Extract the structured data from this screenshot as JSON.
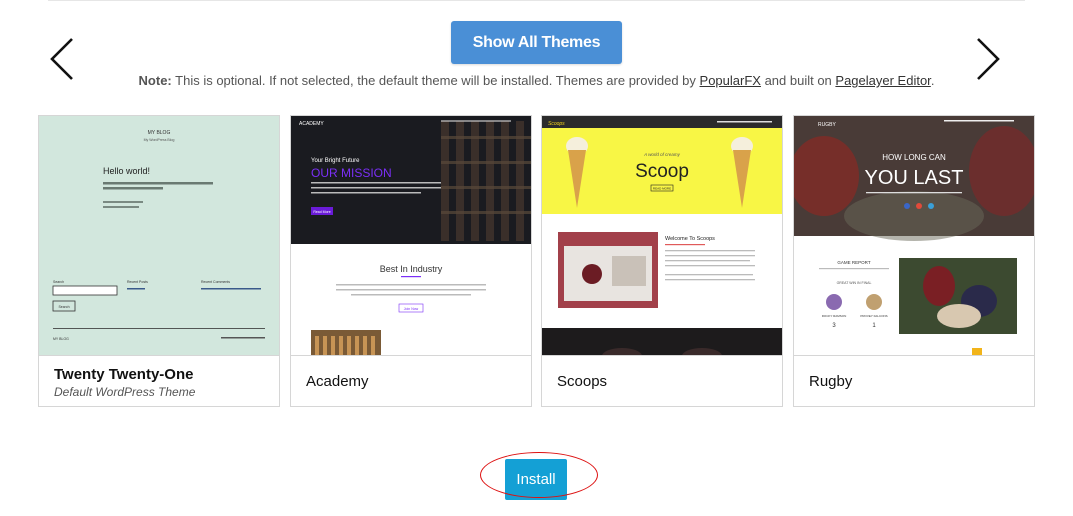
{
  "nav": {
    "prev_icon": "chevron-left-icon",
    "next_icon": "chevron-right-icon"
  },
  "show_all_label": "Show All Themes",
  "note": {
    "prefix": "Note:",
    "text": " This is optional. If not selected, the default theme will be installed. Themes are provided by ",
    "link1": "PopularFX",
    "mid": " and built on ",
    "link2": "Pagelayer Editor",
    "suffix": "."
  },
  "themes": [
    {
      "name": "Twenty Twenty-One",
      "subtitle": "Default WordPress Theme",
      "thumb": {
        "site_title": "MY BLOG",
        "tagline": "My WordPress Blog",
        "heading": "Hello world!",
        "footer_left": "MY BLOG",
        "search_label": "Search",
        "recent_posts": "Recent Posts",
        "recent_comments": "Recent Comments",
        "search_button": "Search"
      }
    },
    {
      "name": "Academy",
      "subtitle": "",
      "thumb": {
        "logo": "ACADEMY",
        "kicker": "Your Bright Future",
        "headline": "OUR MISSION",
        "button": "Read More",
        "section": "Best In Industry",
        "section_button": "Join Now"
      }
    },
    {
      "name": "Scoops",
      "subtitle": "",
      "thumb": {
        "logo": "Scoops",
        "script": "A world of creamy",
        "title": "Scoop",
        "button": "READ MORE",
        "welcome": "Welcome To Scoops"
      }
    },
    {
      "name": "Rugby",
      "subtitle": "",
      "thumb": {
        "logo": "RUGBY",
        "line1": "HOW LONG CAN",
        "line2": "YOU LAST",
        "report": "GAME REPORT",
        "sub": "GREAT WIN IN FINAL",
        "team1": "ROCKY RAMSON",
        "team2": "PROVEY FALCONS",
        "score1": "3",
        "score2": "1"
      }
    }
  ],
  "install_label": "Install",
  "colors": {
    "primary_button": "#4a8fd6",
    "install_button": "#14a0d5",
    "highlight_ring": "#dd1111"
  }
}
